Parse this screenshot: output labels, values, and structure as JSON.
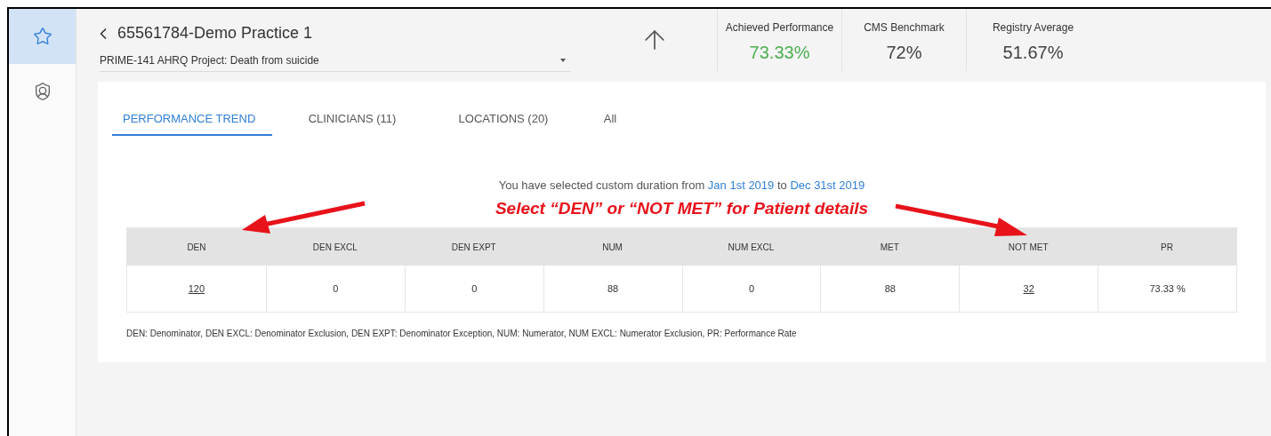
{
  "sidebar": {
    "items": [
      {
        "kind": "star",
        "selected": true
      },
      {
        "kind": "shield",
        "selected": false
      }
    ]
  },
  "header": {
    "title": "65561784-Demo Practice 1",
    "measure": "PRIME-141 AHRQ Project: Death from suicide",
    "stats": [
      {
        "label": "Achieved Performance",
        "value": "73.33%",
        "color": "#4caf50"
      },
      {
        "label": "CMS Benchmark",
        "value": "72%",
        "color": "#424242"
      },
      {
        "label": "Registry Average",
        "value": "51.67%",
        "color": "#424242"
      }
    ]
  },
  "tabs": [
    {
      "label": "PERFORMANCE TREND",
      "selected": true
    },
    {
      "label": "CLINICIANS (11)",
      "selected": false
    },
    {
      "label": "LOCATIONS (20)",
      "selected": false
    },
    {
      "label": "All",
      "selected": false
    }
  ],
  "duration": {
    "text": "You have selected custom duration from",
    "from": "Jan 1st 2019",
    "joiner": "to",
    "to": "Dec 31st 2019"
  },
  "annotation": "Select “DEN” or “NOT MET” for Patient details",
  "table": {
    "columns": [
      "DEN",
      "DEN EXCL",
      "DEN EXPT",
      "NUM",
      "NUM EXCL",
      "MET",
      "NOT MET",
      "PR"
    ],
    "rows": [
      [
        {
          "text": "120",
          "kind": "link"
        },
        {
          "text": "0",
          "kind": "plain"
        },
        {
          "text": "0",
          "kind": "plain"
        },
        {
          "text": "88",
          "kind": "plain"
        },
        {
          "text": "0",
          "kind": "plain"
        },
        {
          "text": "88",
          "kind": "plain"
        },
        {
          "text": "32",
          "kind": "link"
        },
        {
          "text": "73.33 %",
          "kind": "plain"
        }
      ]
    ]
  },
  "legend": "DEN: Denominator, DEN EXCL: Denominator Exclusion, DEN EXPT: Denominator Exception, NUM: Numerator, NUM EXCL: Numerator Exclusion, PR: Performance Rate"
}
